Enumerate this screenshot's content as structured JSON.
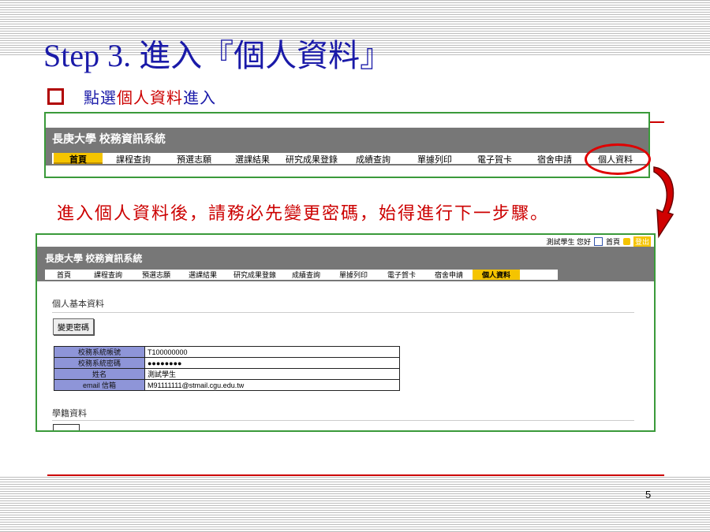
{
  "slide": {
    "title": "Step 3. 進入『個人資料』",
    "bullet_blue": "點選",
    "bullet_red": "個人資料",
    "bullet_blue2": "進入",
    "notice": "進入個人資料後，請務必先變更密碼，始得進行下一步驟。",
    "page_number": "5"
  },
  "screenshot1": {
    "brand": "長庚大學 校務資訊系統",
    "nav": [
      "首頁",
      "課程查詢",
      "預選志願",
      "選課結果",
      "研究成果登錄",
      "成績查詢",
      "單據列印",
      "電子賀卡",
      "宿舍申請",
      "個人資料"
    ]
  },
  "screenshot2": {
    "greeting": "測試學生 您好",
    "home": "首頁",
    "logout": "登出",
    "brand": "長庚大學 校務資訊系統",
    "nav": [
      "首頁",
      "課程查詢",
      "預選志願",
      "選課結果",
      "研究成果登錄",
      "成績查詢",
      "單據列印",
      "電子賀卡",
      "宿舍申請",
      "個人資料"
    ],
    "section1": "個人基本資料",
    "change_password": "變更密碼",
    "rows": [
      {
        "label": "校務系統帳號",
        "value": "T100000000"
      },
      {
        "label": "校務系統密碼",
        "value": "●●●●●●●●"
      },
      {
        "label": "姓名",
        "value": "測試學生"
      },
      {
        "label": "email 信箱",
        "value": "M91111111@stmail.cgu.edu.tw"
      }
    ],
    "section2": "學籍資料"
  },
  "colors": {
    "title_blue": "#1a1aa8",
    "accent_red": "#cc0000",
    "nav_active": "#f5c400",
    "frame_green": "#3a9a3a"
  }
}
